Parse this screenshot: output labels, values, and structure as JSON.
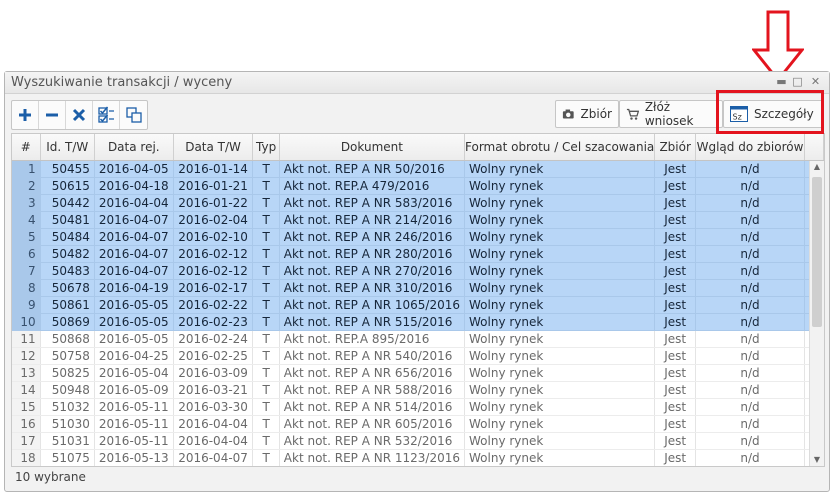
{
  "window": {
    "title": "Wyszukiwanie transakcji / wyceny"
  },
  "toolbar": {
    "icons": [
      "plus-icon",
      "minus-icon",
      "close-x-icon",
      "check-list-icon",
      "copy-window-icon"
    ],
    "zbior_label": "Zbiór",
    "zloz_label": "Złóż wniosek",
    "szczegoly_label": "Szczegóły"
  },
  "annotation": {
    "arrow_color": "#e3141e",
    "highlight_color": "#e3141e"
  },
  "columns": [
    "#",
    "Id. T/W",
    "Data rej.",
    "Data T/W",
    "Typ",
    "Dokument",
    "Format obrotu / Cel szacowania",
    "Zbiór",
    "Wgląd do zbiorów"
  ],
  "rows": [
    {
      "n": "1",
      "id": "50455",
      "reg": "2016-04-05",
      "tw": "2016-01-14",
      "typ": "T",
      "doc": "Akt not. REP A NR 50/2016",
      "fmt": "Wolny rynek",
      "zb": "Jest",
      "wg": "n/d",
      "selected": true
    },
    {
      "n": "2",
      "id": "50615",
      "reg": "2016-04-18",
      "tw": "2016-01-21",
      "typ": "T",
      "doc": "Akt not. REP.A 479/2016",
      "fmt": "Wolny rynek",
      "zb": "Jest",
      "wg": "n/d",
      "selected": true
    },
    {
      "n": "3",
      "id": "50442",
      "reg": "2016-04-04",
      "tw": "2016-01-22",
      "typ": "T",
      "doc": "Akt not. REP A NR 583/2016",
      "fmt": "Wolny rynek",
      "zb": "Jest",
      "wg": "n/d",
      "selected": true
    },
    {
      "n": "4",
      "id": "50481",
      "reg": "2016-04-07",
      "tw": "2016-02-04",
      "typ": "T",
      "doc": "Akt not. REP A NR 214/2016",
      "fmt": "Wolny rynek",
      "zb": "Jest",
      "wg": "n/d",
      "selected": true
    },
    {
      "n": "5",
      "id": "50484",
      "reg": "2016-04-07",
      "tw": "2016-02-10",
      "typ": "T",
      "doc": "Akt not. REP A NR 246/2016",
      "fmt": "Wolny rynek",
      "zb": "Jest",
      "wg": "n/d",
      "selected": true
    },
    {
      "n": "6",
      "id": "50482",
      "reg": "2016-04-07",
      "tw": "2016-02-12",
      "typ": "T",
      "doc": "Akt not. REP A NR 280/2016",
      "fmt": "Wolny rynek",
      "zb": "Jest",
      "wg": "n/d",
      "selected": true
    },
    {
      "n": "7",
      "id": "50483",
      "reg": "2016-04-07",
      "tw": "2016-02-12",
      "typ": "T",
      "doc": "Akt not. REP A NR 270/2016",
      "fmt": "Wolny rynek",
      "zb": "Jest",
      "wg": "n/d",
      "selected": true
    },
    {
      "n": "8",
      "id": "50678",
      "reg": "2016-04-19",
      "tw": "2016-02-17",
      "typ": "T",
      "doc": "Akt not. REP A NR 310/2016",
      "fmt": "Wolny rynek",
      "zb": "Jest",
      "wg": "n/d",
      "selected": true
    },
    {
      "n": "9",
      "id": "50861",
      "reg": "2016-05-05",
      "tw": "2016-02-22",
      "typ": "T",
      "doc": "Akt not. REP A NR 1065/2016",
      "fmt": "Wolny rynek",
      "zb": "Jest",
      "wg": "n/d",
      "selected": true
    },
    {
      "n": "10",
      "id": "50869",
      "reg": "2016-05-05",
      "tw": "2016-02-23",
      "typ": "T",
      "doc": "Akt not. REP A NR 515/2016",
      "fmt": "Wolny rynek",
      "zb": "Jest",
      "wg": "n/d",
      "selected": true
    },
    {
      "n": "11",
      "id": "50868",
      "reg": "2016-05-05",
      "tw": "2016-02-24",
      "typ": "T",
      "doc": "Akt not. REP.A 895/2016",
      "fmt": "Wolny rynek",
      "zb": "Jest",
      "wg": "n/d",
      "selected": false
    },
    {
      "n": "12",
      "id": "50758",
      "reg": "2016-04-25",
      "tw": "2016-02-25",
      "typ": "T",
      "doc": "Akt not. REP A NR 540/2016",
      "fmt": "Wolny rynek",
      "zb": "Jest",
      "wg": "n/d",
      "selected": false
    },
    {
      "n": "13",
      "id": "50825",
      "reg": "2016-05-04",
      "tw": "2016-03-09",
      "typ": "T",
      "doc": "Akt not. REP A NR 656/2016",
      "fmt": "Wolny rynek",
      "zb": "Jest",
      "wg": "n/d",
      "selected": false
    },
    {
      "n": "14",
      "id": "50948",
      "reg": "2016-05-09",
      "tw": "2016-03-21",
      "typ": "T",
      "doc": "Akt not. REP A NR 588/2016",
      "fmt": "Wolny rynek",
      "zb": "Jest",
      "wg": "n/d",
      "selected": false
    },
    {
      "n": "15",
      "id": "51032",
      "reg": "2016-05-11",
      "tw": "2016-03-30",
      "typ": "T",
      "doc": "Akt not. REP A NR 514/2016",
      "fmt": "Wolny rynek",
      "zb": "Jest",
      "wg": "n/d",
      "selected": false
    },
    {
      "n": "16",
      "id": "51030",
      "reg": "2016-05-11",
      "tw": "2016-04-04",
      "typ": "T",
      "doc": "Akt not. REP A NR 605/2016",
      "fmt": "Wolny rynek",
      "zb": "Jest",
      "wg": "n/d",
      "selected": false
    },
    {
      "n": "17",
      "id": "51031",
      "reg": "2016-05-11",
      "tw": "2016-04-04",
      "typ": "T",
      "doc": "Akt not. REP A NR 532/2016",
      "fmt": "Wolny rynek",
      "zb": "Jest",
      "wg": "n/d",
      "selected": false
    },
    {
      "n": "18",
      "id": "51075",
      "reg": "2016-05-13",
      "tw": "2016-04-07",
      "typ": "T",
      "doc": "Akt not. REP A NR 1123/2016",
      "fmt": "Wolny rynek",
      "zb": "Jest",
      "wg": "n/d",
      "selected": false
    }
  ],
  "footer": {
    "status": "10 wybrane"
  }
}
